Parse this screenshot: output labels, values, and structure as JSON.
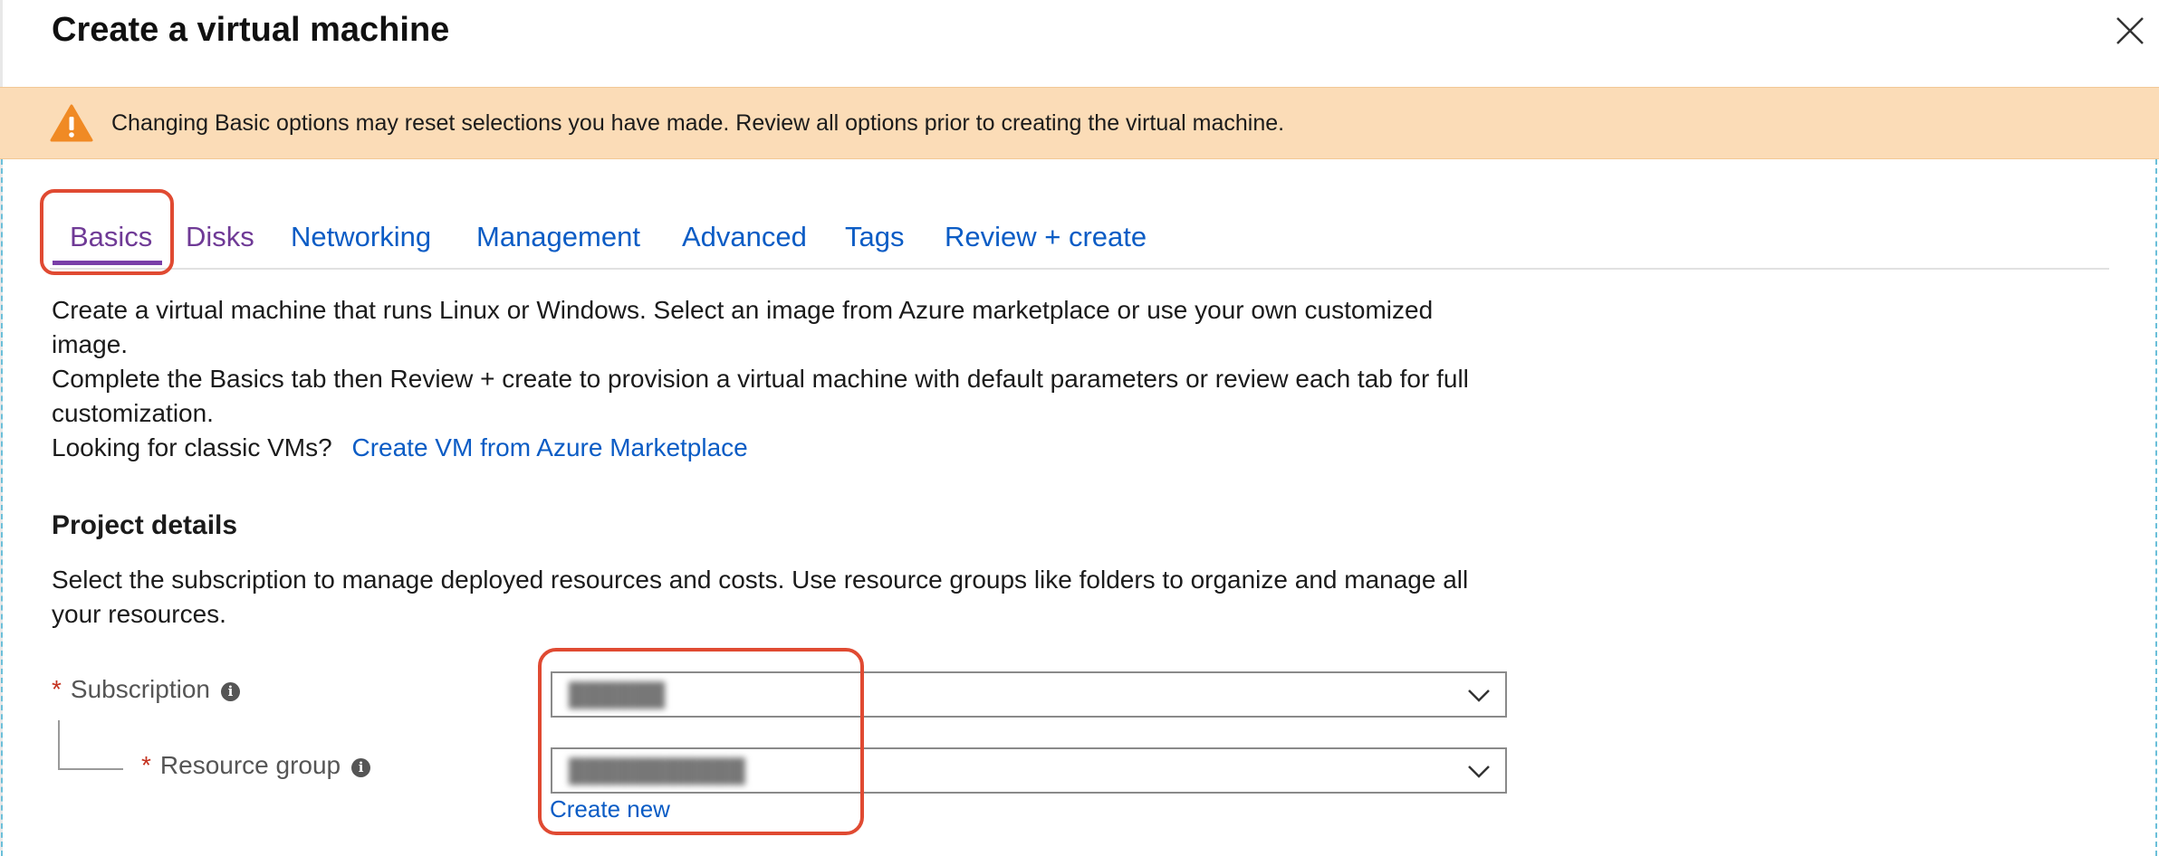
{
  "window": {
    "title": "Create a virtual machine",
    "close_icon": "close-icon"
  },
  "warning": {
    "icon": "warning-triangle-icon",
    "text": "Changing Basic options may reset selections you have made. Review all options prior to creating the virtual machine."
  },
  "tabs": [
    {
      "label": "Basics",
      "selected": true
    },
    {
      "label": "Disks"
    },
    {
      "label": "Networking"
    },
    {
      "label": "Management"
    },
    {
      "label": "Advanced"
    },
    {
      "label": "Tags"
    },
    {
      "label": "Review + create"
    }
  ],
  "intro": {
    "line1": "Create a virtual machine that runs Linux or Windows. Select an image from Azure marketplace or use your own customized",
    "line2": "image.",
    "line3": "Complete the Basics tab then Review + create to provision a virtual machine with default parameters or review each tab for full",
    "line4": "customization.",
    "classic_prompt": "Looking for classic VMs?",
    "classic_link": "Create VM from Azure Marketplace"
  },
  "project_details": {
    "title": "Project details",
    "desc_line1": "Select the subscription to manage deployed resources and costs. Use resource groups like folders to organize and manage all",
    "desc_line2": "your resources.",
    "subscription": {
      "required_mark": "*",
      "label": "Subscription",
      "info": "i",
      "value": "██████"
    },
    "resource_group": {
      "required_mark": "*",
      "label": "Resource group",
      "info": "i",
      "value": "███████████",
      "create_new": "Create new"
    }
  },
  "colors": {
    "link": "#0b5cc5",
    "visited_tab": "#6f3a96",
    "warning_bg": "#fbdcb7",
    "highlight": "#e04a32",
    "required": "#c4311e"
  }
}
